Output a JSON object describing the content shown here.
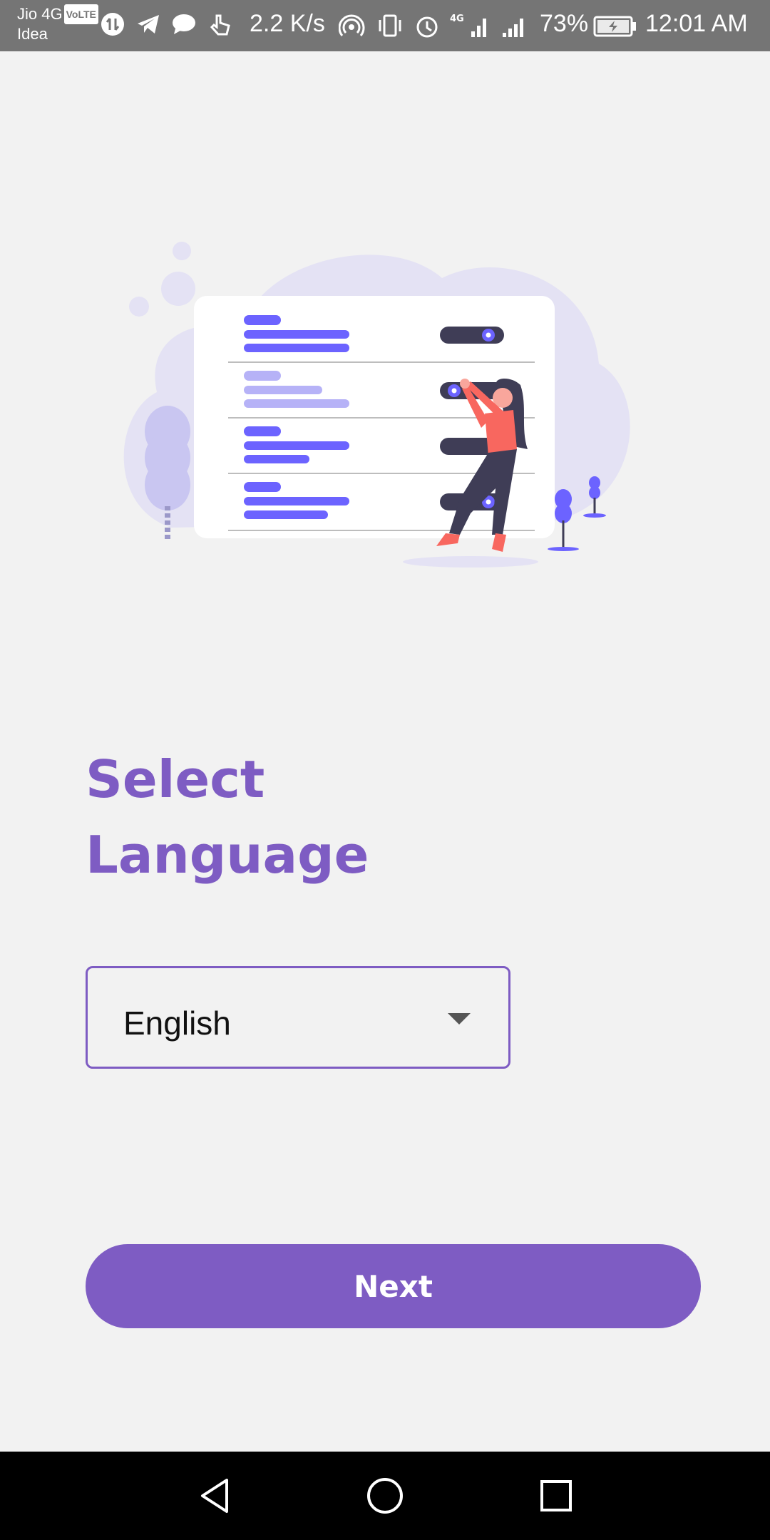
{
  "status_bar": {
    "carrier_1": "Jio 4G",
    "volte": "VoLTE",
    "carrier_2": "Idea",
    "network_speed": "2.2 K/s",
    "battery_percent": "73%",
    "time": "12:01 AM",
    "icons": [
      "data-saver-icon",
      "telegram-icon",
      "chat-icon",
      "tap-icon",
      "hotspot-icon",
      "vibrate-icon",
      "alarm-icon",
      "signal-4g-icon",
      "signal-icon",
      "battery-charging-icon"
    ]
  },
  "illustration": {
    "name": "settings-toggles-illustration"
  },
  "title": {
    "line1": "Select",
    "line2": "Language"
  },
  "language_select": {
    "value": "English"
  },
  "next_button": {
    "label": "Next"
  },
  "colors": {
    "accent": "#7e5cc3",
    "background": "#f2f2f2",
    "status_bar": "#757575",
    "nav_bar": "#000000"
  },
  "nav_bar": {
    "icons": [
      "back-icon",
      "home-icon",
      "recents-icon"
    ]
  }
}
